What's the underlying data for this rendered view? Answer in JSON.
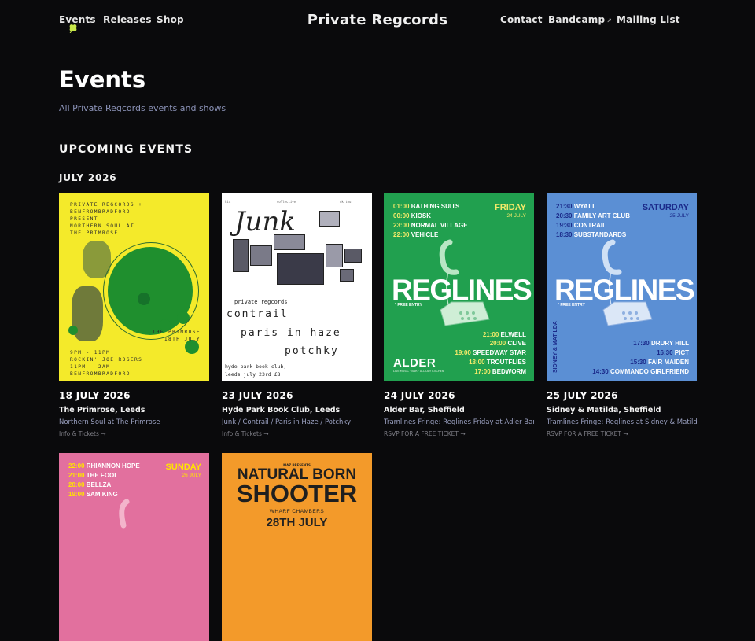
{
  "nav": {
    "left": [
      "Events",
      "Releases",
      "Shop"
    ],
    "brand": "Private Regcords",
    "right": [
      "Contact",
      "Bandcamp",
      "Mailing List"
    ],
    "external_icon": "↗"
  },
  "header": {
    "title": "Events",
    "subtitle": "All Private Regcords events and shows"
  },
  "section": {
    "heading": "UPCOMING EVENTS",
    "month": "JULY 2026"
  },
  "events": [
    {
      "date": "18 JULY 2026",
      "venue": "The Primrose, Leeds",
      "desc": "Northern Soul at The Primrose",
      "link": "Info & Tickets →",
      "poster": {
        "top_lines": [
          "PRIVATE REGCORDS +",
          "BENFROMBRADFORD",
          "PRESENT",
          "NORTHERN SOUL AT",
          "THE PRIMROSE"
        ],
        "venue_lines": [
          "THE PRIMROSE",
          "18TH JULY"
        ],
        "bottom_lines": [
          "9PM - 11PM",
          "ROCKIN' JOE ROGERS",
          "11PM - 2AM",
          "BENFROMBRADFORD"
        ]
      }
    },
    {
      "date": "23 JULY 2026",
      "venue": "Hyde Park Book Club, Leeds",
      "desc": "Junk / Contrail / Paris in Haze / Potchky",
      "link": "Info & Tickets →",
      "poster": {
        "tiny": [
          "hix",
          "collective",
          "uk tour"
        ],
        "title": "Junk",
        "presents": "private regcords:",
        "acts": [
          "contrail",
          "paris in haze",
          "potchky"
        ],
        "footer1": "hyde park book club,",
        "footer2": "leeds july 23rd £8"
      }
    },
    {
      "date": "24 JULY 2026",
      "venue": "Alder Bar, Sheffield",
      "desc": "Tramlines Fringe: Reglines Friday at Adler Bar",
      "link": "RSVP FOR A FREE TICKET →",
      "poster": {
        "day": "FRIDAY",
        "day_date": "24 JULY",
        "top": [
          [
            "01:00",
            "BATHING SUITS"
          ],
          [
            "00:00",
            "KIOSK"
          ],
          [
            "23:00",
            "NORMAL VILLAGE"
          ],
          [
            "22:00",
            "VEHICLE"
          ]
        ],
        "title": "REGLINES",
        "free": "* FREE ENTRY",
        "bottom": [
          [
            "21:00",
            "ELWELL"
          ],
          [
            "20:00",
            "CLIVE"
          ],
          [
            "19:00",
            "SPEEDWAY STAR"
          ],
          [
            "18:00",
            "TROUTFLIES"
          ],
          [
            "17:00",
            "BEDWORM"
          ]
        ],
        "venue_logo": "ALDER",
        "venue_sub": "LIVE MUSIC · BAR · ALL DAY KITCHEN"
      }
    },
    {
      "date": "25 JULY 2026",
      "venue": "Sidney & Matilda, Sheffield",
      "desc": "Tramlines Fringe: Reglines at Sidney & Matilda",
      "link": "RSVP FOR A FREE TICKET →",
      "poster": {
        "day": "SATURDAY",
        "day_date": "25 JULY",
        "top": [
          [
            "21:30",
            "WYATT"
          ],
          [
            "20:30",
            "FAMILY ART CLUB"
          ],
          [
            "19:30",
            "CONTRAIL"
          ],
          [
            "18:30",
            "SUBSTANDARDS"
          ]
        ],
        "title": "REGLINES",
        "free": "* FREE ENTRY",
        "bottom": [
          [
            "17:30",
            "DRURY HILL"
          ],
          [
            "16:30",
            "PICT"
          ],
          [
            "15:30",
            "FAIR MAIDEN"
          ],
          [
            "14:30",
            "COMMANDO GIRLFRIEND"
          ]
        ],
        "venue_logo": "SIDNEY & MATILDA"
      }
    },
    {
      "poster": {
        "day": "SUNDAY",
        "day_date": "26 JULY",
        "top": [
          [
            "22:00",
            "RHIANNON HOPE"
          ],
          [
            "21:00",
            "THE FOOL"
          ],
          [
            "20:00",
            "BELLZA"
          ],
          [
            "19:00",
            "SAM KING"
          ]
        ]
      }
    },
    {
      "poster": {
        "presents": "MAZ PRESENTS",
        "line1": "NATURAL BORN",
        "line2": "SHOOTER",
        "venue": "WHARF CHAMBERS",
        "date": "28TH JULY"
      }
    }
  ],
  "colors": {
    "background": "#0a0a0c",
    "accent_clover": "#c8e84a",
    "subtitle": "#8c93b8",
    "yellow": "#f4ea2a",
    "green": "#21a04f",
    "blue": "#5b8fd4",
    "pink": "#e2709e",
    "orange": "#f39a2a"
  }
}
